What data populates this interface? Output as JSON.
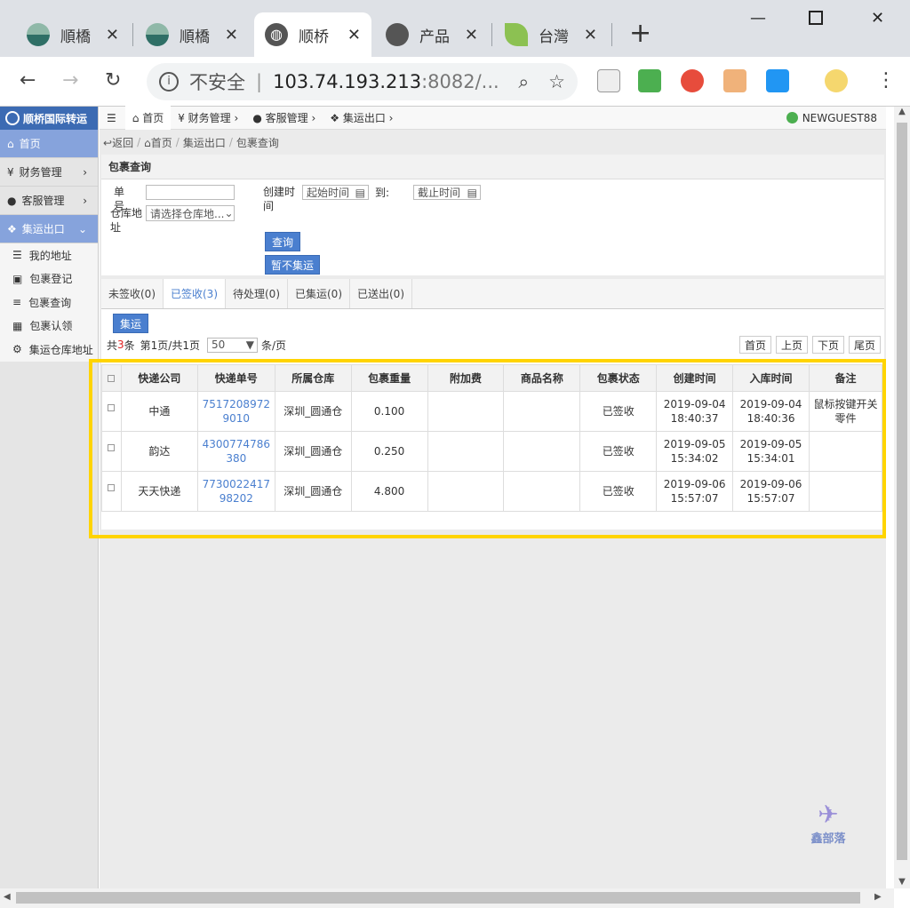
{
  "browser": {
    "tabs": [
      {
        "title": "順橋",
        "active": false
      },
      {
        "title": "順橋",
        "active": false
      },
      {
        "title": "顺桥",
        "active": true
      },
      {
        "title": "产品",
        "active": false
      },
      {
        "title": "台灣",
        "active": false
      }
    ],
    "new_tab": "+",
    "insecure_label": "不安全",
    "url_host": "103.74.193.213",
    "url_rest": ":8082/..."
  },
  "sidebar": {
    "brand": "顺桥国际转运",
    "items": [
      {
        "label": "首页",
        "icon": "home-icon"
      },
      {
        "label": "财务管理",
        "icon": "yen-icon"
      },
      {
        "label": "客服管理",
        "icon": "user-icon"
      },
      {
        "label": "集运出口",
        "icon": "cubes-icon"
      }
    ],
    "subitems": [
      "我的地址",
      "包裹登记",
      "包裹查询",
      "包裹认领",
      "集运仓库地址"
    ]
  },
  "topnav": {
    "items": [
      "首页",
      "财务管理",
      "客服管理",
      "集运出口"
    ],
    "user": "NEWGUEST88"
  },
  "breadcrumb": {
    "back": "返回",
    "items": [
      "首页",
      "集运出口",
      "包裹查询"
    ]
  },
  "search": {
    "title": "包裹查询",
    "order_label": "单号",
    "warehouse_label": "仓库地址",
    "warehouse_placeholder": "请选择仓库地...",
    "created_label": "创建时间",
    "start_placeholder": "起始时间",
    "to_label": "到:",
    "end_placeholder": "截止时间",
    "query_btn": "查询",
    "hold_btn": "暂不集运"
  },
  "status_tabs": [
    "未签收(0)",
    "已签收(3)",
    "待处理(0)",
    "已集运(0)",
    "已送出(0)"
  ],
  "consolidate_btn": "集运",
  "pagination": {
    "total_prefix": "共",
    "total": "3",
    "total_suffix": "条",
    "page_info": "第1页/共1页",
    "page_size": "50",
    "per_page": "条/页",
    "first": "首页",
    "prev": "上页",
    "next": "下页",
    "last": "尾页"
  },
  "table": {
    "headers": [
      "快递公司",
      "快递单号",
      "所属仓库",
      "包裹重量",
      "附加费",
      "商品名称",
      "包裹状态",
      "创建时间",
      "入库时间",
      "备注"
    ],
    "rows": [
      {
        "company": "中通",
        "tracking1": "7517208972",
        "tracking2": "9010",
        "warehouse": "深圳_圆通仓",
        "weight": "0.100",
        "fee": "",
        "product": "",
        "status": "已签收",
        "created_date": "2019-09-04",
        "created_time": "18:40:37",
        "inbound_date": "2019-09-04",
        "inbound_time": "18:40:36",
        "remark": "鼠标按键开关零件"
      },
      {
        "company": "韵达",
        "tracking1": "4300774786",
        "tracking2": "380",
        "warehouse": "深圳_圆通仓",
        "weight": "0.250",
        "fee": "",
        "product": "",
        "status": "已签收",
        "created_date": "2019-09-05",
        "created_time": "15:34:02",
        "inbound_date": "2019-09-05",
        "inbound_time": "15:34:01",
        "remark": ""
      },
      {
        "company": "天天快递",
        "tracking1": "7730022417",
        "tracking2": "98202",
        "warehouse": "深圳_圆通仓",
        "weight": "4.800",
        "fee": "",
        "product": "",
        "status": "已签收",
        "created_date": "2019-09-06",
        "created_time": "15:57:07",
        "inbound_date": "2019-09-06",
        "inbound_time": "15:57:07",
        "remark": ""
      }
    ]
  },
  "watermark": "鑫部落",
  "colors": {
    "accent": "#4a7fcf",
    "highlight": "#ffd400",
    "sidebar_active": "#86a3dc"
  }
}
